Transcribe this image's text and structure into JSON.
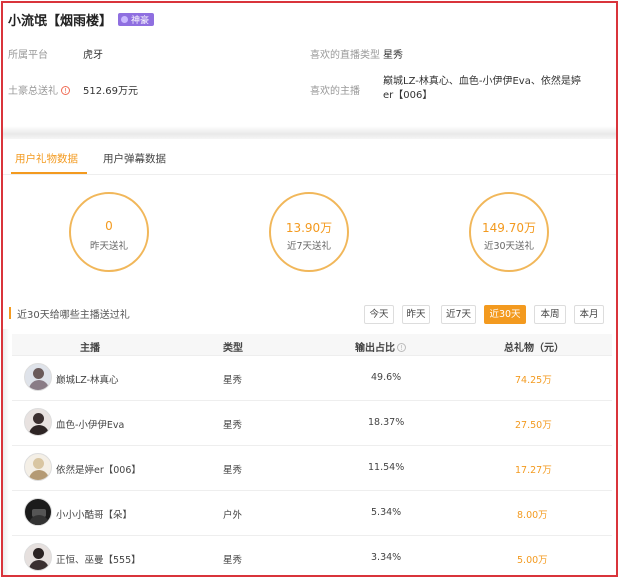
{
  "header": {
    "user_name": "小流氓【烟雨楼】",
    "badge_label": "神豪",
    "platform_label": "所属平台",
    "platform_value": "虎牙",
    "fav_type_label": "喜欢的直播类型",
    "fav_type_value": "星秀",
    "total_gift_label": "土豪总送礼",
    "total_gift_value": "512.69万元",
    "fav_streamers_label": "喜欢的主播",
    "fav_streamers_value": "巅城LZ-林真心、血色-小伊伊Eva、依然是婷er【006】"
  },
  "tabs": [
    {
      "label": "用户礼物数据",
      "active": true
    },
    {
      "label": "用户弹幕数据",
      "active": false
    }
  ],
  "stats": [
    {
      "value": "0",
      "label": "昨天送礼"
    },
    {
      "value": "13.90万",
      "label": "近7天送礼"
    },
    {
      "value": "149.70万",
      "label": "近30天送礼"
    }
  ],
  "section": {
    "title": "近30天给哪些主播送过礼",
    "filters": [
      {
        "label": "今天",
        "active": false
      },
      {
        "label": "昨天",
        "active": false
      },
      {
        "label": "近7天",
        "active": false
      },
      {
        "label": "近30天",
        "active": true
      },
      {
        "label": "本周",
        "active": false
      },
      {
        "label": "本月",
        "active": false
      }
    ]
  },
  "table": {
    "columns": [
      "主播",
      "类型",
      "输出占比",
      "总礼物（元）"
    ],
    "rows": [
      {
        "streamer": "巅城LZ-林真心",
        "type": "星秀",
        "share": "49.6%",
        "total": "74.25万"
      },
      {
        "streamer": "血色-小伊伊Eva",
        "type": "星秀",
        "share": "18.37%",
        "total": "27.50万"
      },
      {
        "streamer": "依然是婷er【006】",
        "type": "星秀",
        "share": "11.54%",
        "total": "17.27万"
      },
      {
        "streamer": "小小小酷哥【朵】",
        "type": "户外",
        "share": "5.34%",
        "total": "8.00万"
      },
      {
        "streamer": "正恒、巫曼【555】",
        "type": "星秀",
        "share": "3.34%",
        "total": "5.00万"
      }
    ]
  },
  "colors": {
    "accent": "#f39a1f",
    "badge": "#8f6fe0",
    "frame": "#d9343b"
  }
}
